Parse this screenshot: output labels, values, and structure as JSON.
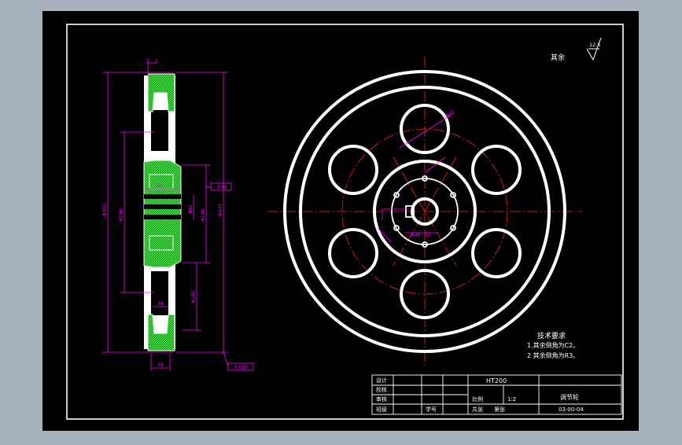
{
  "roughness": {
    "symbol_label": "其余",
    "value": "12.5"
  },
  "tech": {
    "title": "技术要求",
    "line1": "1.其余倒角为C2。",
    "line2": "2  其余倒角为R3。"
  },
  "title_block": {
    "material": "HT200",
    "part_name": "调节轮",
    "scale_label": "比例",
    "scale_value": "1:2",
    "sheets": "共张",
    "sheet_no": "第张",
    "drawing_no": "03-00-04",
    "row_labels": [
      "设计",
      "校核",
      "审核",
      "班级"
    ],
    "student_no_label": "学号"
  },
  "dims": {
    "top": "2",
    "phi_outer": "Φ450",
    "phi_rim": "Φ430",
    "phi_circle": "Φ230",
    "phi_hub": "Φ140",
    "phi_bore": "Φ81",
    "phi_hole": "Φ185",
    "hub_w": "25",
    "rim_w1": "34",
    "rim_w2": "34",
    "tol1": "0.01",
    "tol2": "0.025",
    "hole_callout": "Φ60",
    "keyway": "Φ46",
    "keyway_w": "10"
  },
  "colors": {
    "paper": "#000000",
    "frame": "#ffffff",
    "part": "#ffffff",
    "hatch": "#2bff2b",
    "dim": "#ff00ff",
    "center": "#ff2020"
  }
}
